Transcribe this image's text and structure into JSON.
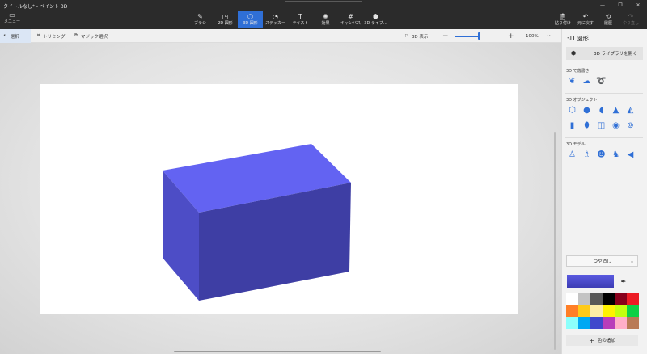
{
  "app": {
    "title": "タイトルなし* - ペイント 3D"
  },
  "window": {
    "minimize": "—",
    "restore": "❐",
    "close": "✕"
  },
  "menu": {
    "label": "メニュー",
    "icon": "folder-icon"
  },
  "tools": [
    {
      "label": "ブラシ",
      "icon": "brush-icon",
      "active": false
    },
    {
      "label": "2D 図形",
      "icon": "2d-shapes-icon",
      "active": false
    },
    {
      "label": "3D 図形",
      "icon": "3d-shapes-icon",
      "active": true
    },
    {
      "label": "ステッカー",
      "icon": "sticker-icon",
      "active": false
    },
    {
      "label": "テキスト",
      "icon": "text-icon",
      "active": false
    },
    {
      "label": "効果",
      "icon": "effects-icon",
      "active": false
    },
    {
      "label": "キャンバス",
      "icon": "canvas-icon",
      "active": false
    },
    {
      "label": "3D ライブ...",
      "icon": "3d-library-icon",
      "active": false
    }
  ],
  "right_tools": [
    {
      "label": "貼り付け",
      "icon": "paste-icon",
      "enabled": true
    },
    {
      "label": "元に戻す",
      "icon": "undo-icon",
      "enabled": true
    },
    {
      "label": "履歴",
      "icon": "history-icon",
      "enabled": true
    },
    {
      "label": "やり直し",
      "icon": "redo-icon",
      "enabled": false
    }
  ],
  "subbar": {
    "select": "選択",
    "trim": "トリミング",
    "magic_select": "マジック選択",
    "view3d": "3D 表示",
    "zoom_minus": "−",
    "zoom_plus": "+",
    "zoom": "100%",
    "zoom_level": 0.5,
    "more": "···"
  },
  "panel": {
    "title": "3D 図形",
    "library_button": "3D ライブラリを開く",
    "sections": {
      "doodle": "3D で落書き",
      "objects": "3D オブジェクト",
      "models": "3D モデル"
    },
    "doodle_icons": [
      "sharp-doodle-icon",
      "soft-doodle-icon",
      "tube-doodle-icon"
    ],
    "object_icons": [
      "cube-icon",
      "sphere-icon",
      "hemisphere-icon",
      "cone-icon",
      "pyramid-icon",
      "cylinder-icon",
      "capsule-icon",
      "tube-icon",
      "donut-icon",
      "torus-icon"
    ],
    "model_icons": [
      "man-model-icon",
      "woman-model-icon",
      "dog-model-icon",
      "cat-model-icon",
      "fish-model-icon"
    ],
    "finish": "つや消し",
    "current_color": "#4f4fd6",
    "add_color": "色の追加",
    "palette": [
      "#ffffff",
      "#c3c3c3",
      "#585858",
      "#000000",
      "#88001b",
      "#ec1c24",
      "#ff7f27",
      "#ffca18",
      "#fdeca6",
      "#fff200",
      "#c4ff0e",
      "#0ed145",
      "#8cfffb",
      "#00a8f3",
      "#3f48cc",
      "#b83dba",
      "#ffaec8",
      "#b97a56"
    ]
  },
  "scene": {
    "object": "cube",
    "colors": {
      "top": "#6363f2",
      "left": "#4d4dc6",
      "front": "#3e3ea4"
    }
  }
}
